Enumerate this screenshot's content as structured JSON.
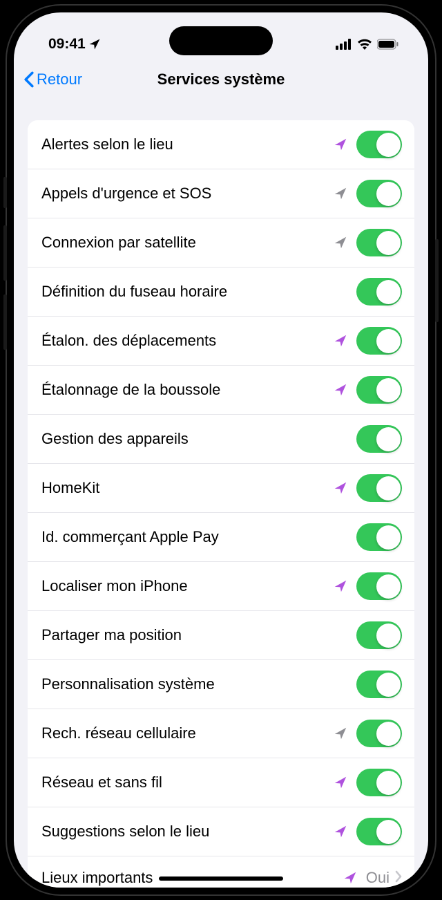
{
  "status": {
    "time": "09:41"
  },
  "nav": {
    "back": "Retour",
    "title": "Services système"
  },
  "items": [
    {
      "label": "Alertes selon le lieu",
      "arrow": "purple",
      "toggle": true
    },
    {
      "label": "Appels d'urgence et SOS",
      "arrow": "gray",
      "toggle": true
    },
    {
      "label": "Connexion par satellite",
      "arrow": "gray",
      "toggle": true
    },
    {
      "label": "Définition du fuseau horaire",
      "arrow": "none",
      "toggle": true
    },
    {
      "label": "Étalon. des déplacements",
      "arrow": "purple",
      "toggle": true
    },
    {
      "label": "Étalonnage de la boussole",
      "arrow": "purple",
      "toggle": true
    },
    {
      "label": "Gestion des appareils",
      "arrow": "none",
      "toggle": true
    },
    {
      "label": "HomeKit",
      "arrow": "purple",
      "toggle": true
    },
    {
      "label": "Id. commerçant Apple Pay",
      "arrow": "none",
      "toggle": true
    },
    {
      "label": "Localiser mon iPhone",
      "arrow": "purple",
      "toggle": true
    },
    {
      "label": "Partager ma position",
      "arrow": "none",
      "toggle": true
    },
    {
      "label": "Personnalisation système",
      "arrow": "none",
      "toggle": true
    },
    {
      "label": "Rech. réseau cellulaire",
      "arrow": "gray",
      "toggle": true
    },
    {
      "label": "Réseau et sans fil",
      "arrow": "purple",
      "toggle": true
    },
    {
      "label": "Suggestions selon le lieu",
      "arrow": "purple",
      "toggle": true
    },
    {
      "label": "Lieux importants",
      "arrow": "purple",
      "value": "Oui",
      "nav": true
    }
  ],
  "colors": {
    "purple": "#af52de",
    "gray": "#8e8e93"
  }
}
